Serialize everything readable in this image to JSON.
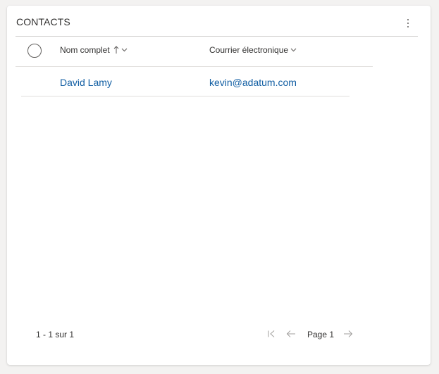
{
  "card": {
    "title": "CONTACTS",
    "more_icon": "more-vertical-icon"
  },
  "grid": {
    "select_all_icon": "select-all-circle-icon",
    "columns": [
      {
        "label": "Nom complet",
        "sort": "ascending",
        "sort_icon": "arrow-up-icon",
        "menu_icon": "chevron-down-icon"
      },
      {
        "label": "Courrier électronique",
        "menu_icon": "chevron-down-icon"
      }
    ],
    "rows": [
      {
        "full_name": "David Lamy",
        "email": "kevin@adatum.com"
      }
    ]
  },
  "footer": {
    "record_count": "1 - 1 sur 1",
    "page_label": "Page 1",
    "first_icon": "first-page-icon",
    "prev_icon": "arrow-left-icon",
    "next_icon": "arrow-right-icon"
  },
  "colors": {
    "link": "#115ea3",
    "text": "#323130",
    "divider": "#d2d0ce",
    "disabled": "#a19f9d"
  }
}
